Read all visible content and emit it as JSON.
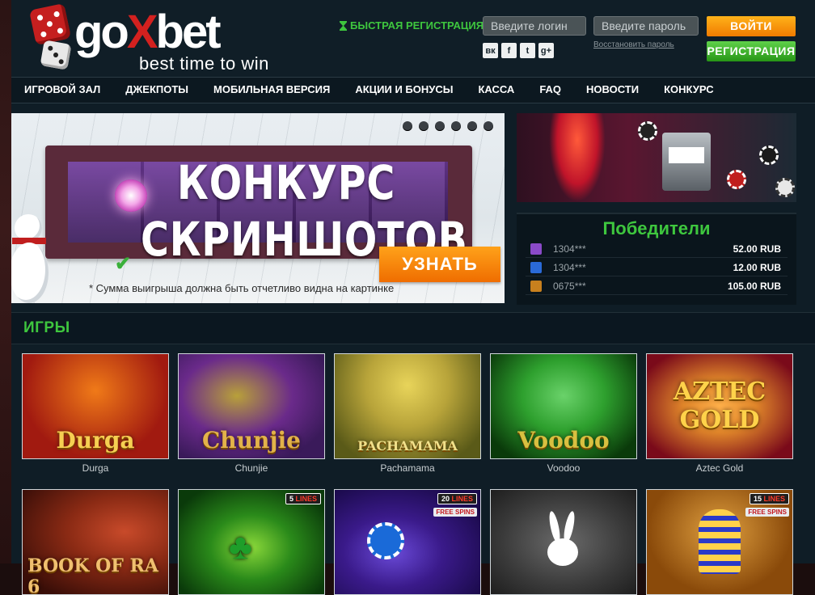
{
  "logo": {
    "word_pre": "go",
    "word_x": "X",
    "word_post": "bet",
    "tagline": "best time to win"
  },
  "header": {
    "quick_reg": "БЫСТРАЯ РЕГИСТРАЦИЯ",
    "login_placeholder": "Введите логин",
    "password_placeholder": "Введите пароль",
    "login_button": "ВОЙТИ",
    "register_button": "РЕГИСТРАЦИЯ",
    "restore_password": "Восстановить пароль",
    "socials": [
      {
        "icon": "vk-icon",
        "glyph": "вк"
      },
      {
        "icon": "facebook-icon",
        "glyph": "f"
      },
      {
        "icon": "twitter-icon",
        "glyph": "t"
      },
      {
        "icon": "google-plus-icon",
        "glyph": "g+"
      }
    ]
  },
  "nav": {
    "items": [
      "ИГРОВОЙ ЗАЛ",
      "ДЖЕКПОТЫ",
      "МОБИЛЬНАЯ ВЕРСИЯ",
      "АКЦИИ И БОНУСЫ",
      "КАССА",
      "FAQ",
      "НОВОСТИ",
      "КОНКУРС"
    ]
  },
  "banner": {
    "line1": "КОНКУРС",
    "line2": "СКРИНШОТОВ",
    "cta": "УЗНАТЬ",
    "note": "* Сумма выигрыша должна быть отчетливо видна на картинке",
    "slides_count": 6
  },
  "winners": {
    "title": "Победители",
    "rows": [
      {
        "user": "1304***",
        "sum": "52.00 RUB",
        "icon_color": "#8a4ac8"
      },
      {
        "user": "1304***",
        "sum": "12.00 RUB",
        "icon_color": "#2a6ad8"
      },
      {
        "user": "0675***",
        "sum": "105.00 RUB",
        "icon_color": "#c8801e"
      }
    ]
  },
  "games": {
    "title": "ИГРЫ",
    "row1": [
      {
        "name": "Durga",
        "label": "Durga",
        "bg": "#a11a10",
        "bg2": "#f07a18",
        "text": "#f5c94a"
      },
      {
        "name": "Chunjie",
        "label": "Chunjie",
        "bg": "#3a1a5a",
        "bg2": "#6a2a8a",
        "text": "#e2b24a"
      },
      {
        "name": "Pachamama",
        "label": "PACHAMAMA",
        "bg": "#5a5a18",
        "bg2": "#b8a43a",
        "text": "#f0e08a"
      },
      {
        "name": "Voodoo",
        "label": "Voodoo",
        "bg": "#0a3a0a",
        "bg2": "#2ea02e",
        "text": "#d8c040"
      },
      {
        "name": "Aztec Gold",
        "label": "AZTEC GOLD",
        "bg": "#7a0a1a",
        "bg2": "#e0862a",
        "text": "#ffd24a"
      }
    ],
    "row2": [
      {
        "label": "BOOK OF RA 6",
        "bg": "#3a0e08",
        "bg2": "#8a2a14",
        "text": "#f0c070",
        "badge": "",
        "free": ""
      },
      {
        "label": "",
        "bg": "#0a3a0a",
        "bg2": "#2a8a1a",
        "text": "#ffd24a",
        "badge": "5",
        "free": ""
      },
      {
        "label": "",
        "bg": "#1a0a4a",
        "bg2": "#3a1a8a",
        "text": "#ffd24a",
        "badge": "20",
        "free": "FREE SPINS"
      },
      {
        "label": "",
        "bg": "#2a2a2a",
        "bg2": "#5a5a5a",
        "text": "#ffffff",
        "badge": "",
        "free": ""
      },
      {
        "label": "",
        "bg": "#8a4a0a",
        "bg2": "#e0a040",
        "text": "#ffd24a",
        "badge": "15",
        "free": "FREE SPINS"
      }
    ],
    "lines_word": "LINES"
  },
  "colors": {
    "accent_green": "#3ec63e",
    "accent_orange": "#f07b00",
    "brand_red": "#d3211f"
  }
}
